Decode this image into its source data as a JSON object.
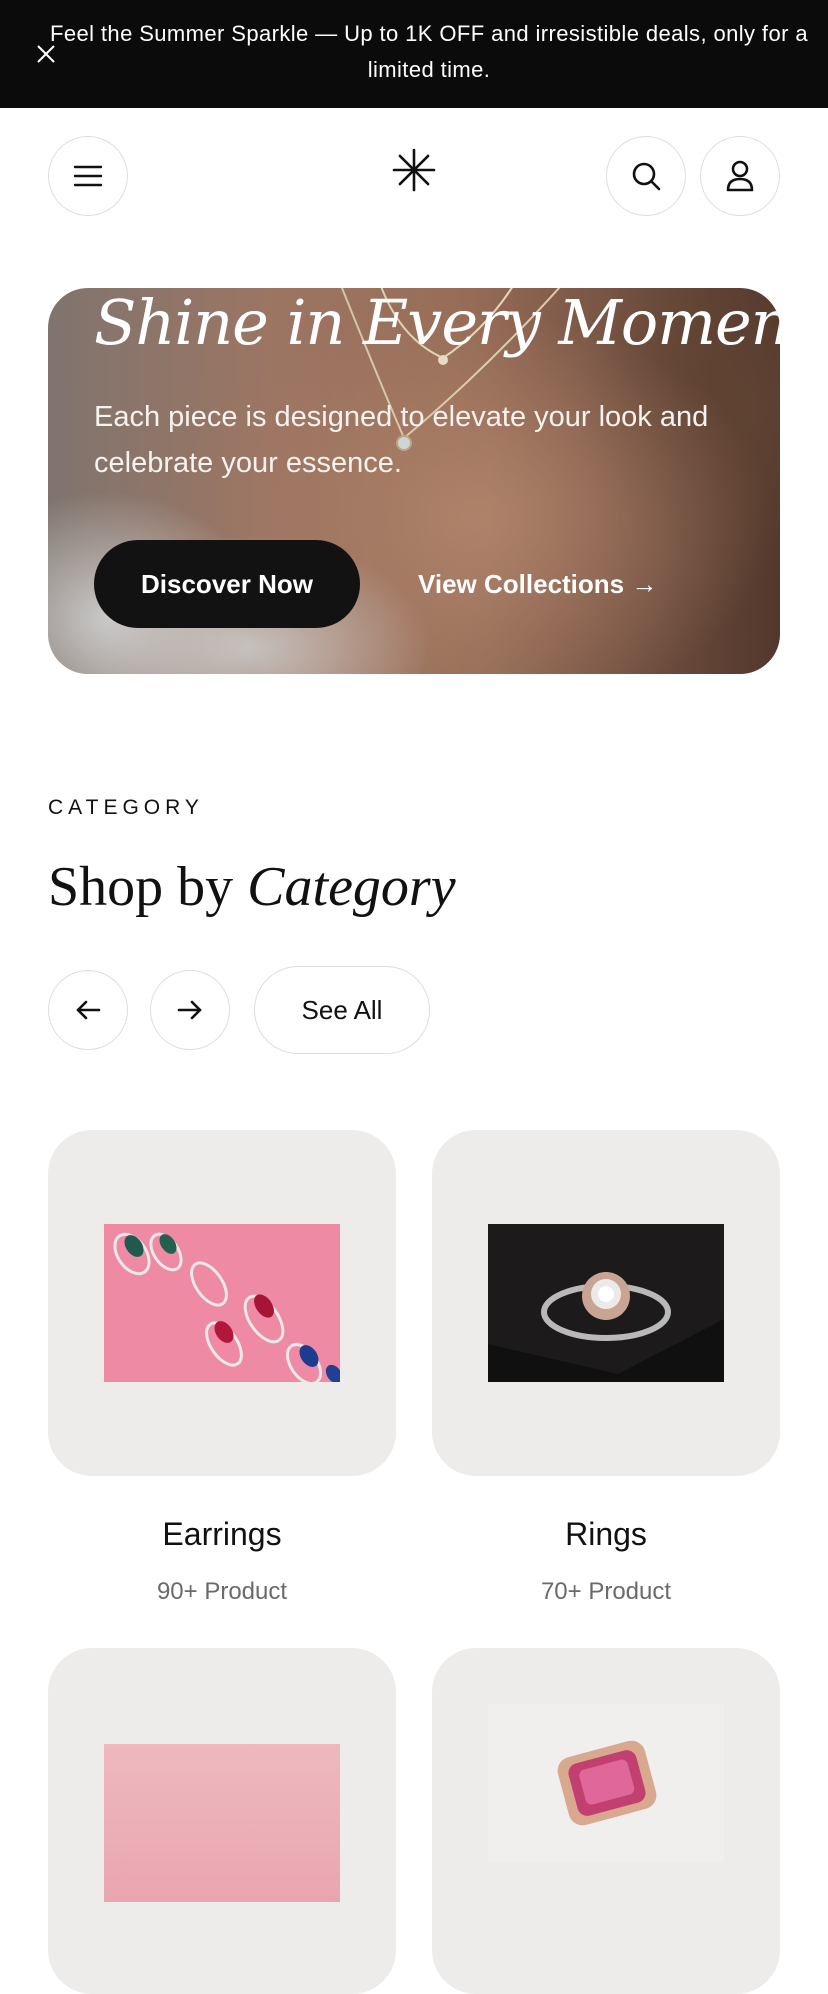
{
  "announcement": {
    "text": "Feel the Summer Sparkle — Up to 1K OFF and irresistible deals, only for a limited time."
  },
  "hero": {
    "title": "Shine in Every Moment",
    "subtitle": "Each piece is designed to elevate your look and celebrate your essence.",
    "primary_cta": "Discover Now",
    "secondary_cta": "View Collections →"
  },
  "category": {
    "eyebrow": "CATEGORY",
    "title_plain": "Shop by",
    "title_italic": "Category",
    "see_all": "See All",
    "items": [
      {
        "name": "Earrings",
        "count": "90+ Product"
      },
      {
        "name": "Rings",
        "count": "70+ Product"
      },
      {
        "name": "",
        "count": ""
      },
      {
        "name": "",
        "count": ""
      }
    ]
  },
  "icons": [
    "close-icon",
    "menu-icon",
    "brand-asterisk-icon",
    "search-icon",
    "user-icon",
    "arrow-left-icon",
    "arrow-right-icon"
  ],
  "colors": {
    "announcement_bg": "#0b0b0b",
    "primary_button": "#121212",
    "card_bg": "#eeecea",
    "border": "#e2ddd8"
  }
}
